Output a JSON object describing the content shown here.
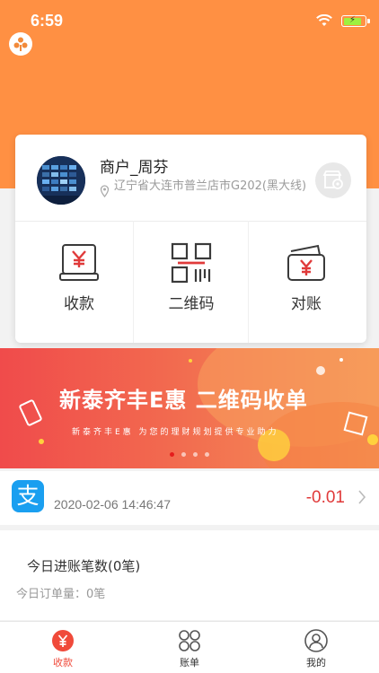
{
  "status_bar": {
    "time": "6:59"
  },
  "merchant": {
    "name": "商户_周芬",
    "address": "辽宁省大连市普兰店市G202(黑大线)"
  },
  "actions": [
    {
      "label": "收款",
      "icon": "yen-card-icon"
    },
    {
      "label": "二维码",
      "icon": "qr-code-icon"
    },
    {
      "label": "对账",
      "icon": "wallet-icon"
    }
  ],
  "banner": {
    "title": "新泰齐丰E惠  二维码收单",
    "subtitle": "新泰齐丰E惠  为您的理财规划提供专业助力",
    "page_count": 4,
    "active_page": 1
  },
  "transaction": {
    "icon": "alipay-icon",
    "icon_glyph": "支",
    "time": "2020-02-06 14:46:47",
    "amount": "-0.01"
  },
  "summary": {
    "title": "今日进账笔数(0笔)",
    "orders": "今日订单量：0笔"
  },
  "tabs": [
    {
      "label": "收款",
      "active": true
    },
    {
      "label": "账单",
      "active": false
    },
    {
      "label": "我的",
      "active": false
    }
  ],
  "colors": {
    "accent": "#ff9043",
    "primary_red": "#f04a3a",
    "alipay_blue": "#1a9ff0"
  }
}
